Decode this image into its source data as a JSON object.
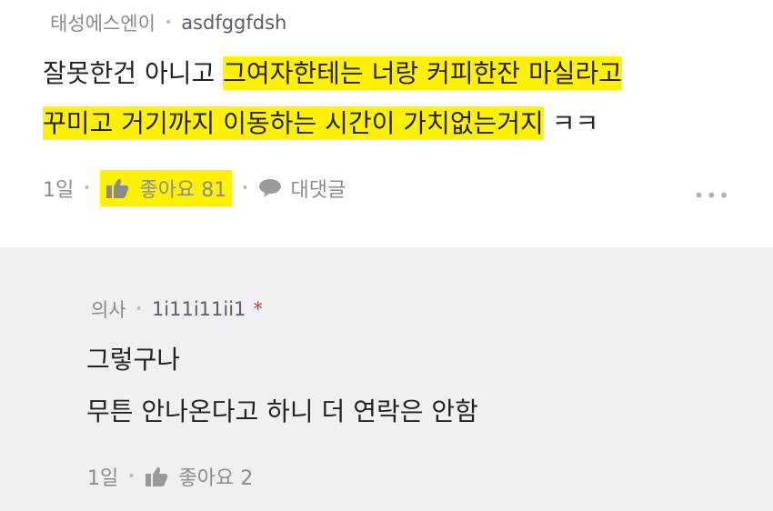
{
  "comment": {
    "author_badge": "태성에스엔이",
    "author_name": "asdfggfdsh",
    "line1_plain": "잘못한건 아니고 ",
    "line1_highlight": "그여자한테는 너랑 커피한잔 마실라고",
    "line2_highlight": "꾸미고 거기까지 이동하는 시간이 가치없는거지",
    "line2_plain": " ㅋㅋ",
    "time": "1일",
    "like_label": "좋아요 81",
    "reply_label": "대댓글",
    "more_label": "•••",
    "highlight_color": "#fff200"
  },
  "reply": {
    "author_badge": "의사",
    "author_name": "1i11i11ii1",
    "author_marker": "*",
    "line1": "그렇구나",
    "line2": "무튼 안나온다고 하니 더 연락은 안함",
    "time": "1일",
    "like_label": "좋아요 2",
    "background_color": "#f0f0f2"
  },
  "icons": [
    "thumbs-up-icon",
    "speech-bubble-icon",
    "more-dots-icon"
  ]
}
